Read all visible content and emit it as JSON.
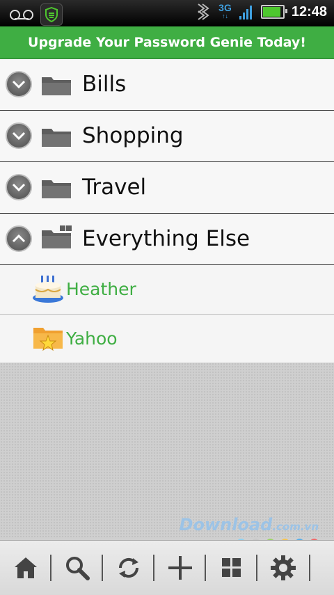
{
  "status_bar": {
    "time": "12:48",
    "network_type": "3G",
    "battery_level": 0.85,
    "icons": [
      "voicemail-icon",
      "lookout-shield-icon",
      "data-sync-icon",
      "3g-icon",
      "signal-icon",
      "battery-icon"
    ]
  },
  "banner": {
    "text": "Upgrade Your Password Genie Today!"
  },
  "folders": [
    {
      "label": "Bills",
      "expanded": false
    },
    {
      "label": "Shopping",
      "expanded": false
    },
    {
      "label": "Travel",
      "expanded": false
    },
    {
      "label": "Everything Else",
      "expanded": true
    }
  ],
  "entries": [
    {
      "label": "Heather",
      "icon": "birthday-cake-icon"
    },
    {
      "label": "Yahoo",
      "icon": "star-folder-icon"
    }
  ],
  "watermark": {
    "text": "Download",
    "suffix": ".com.vn"
  },
  "toolbar": {
    "buttons": [
      "home-icon",
      "search-icon",
      "sync-icon",
      "add-icon",
      "grid-icon",
      "settings-icon"
    ]
  },
  "colors": {
    "accent_green": "#3fae43",
    "status_bar": "#000000",
    "toolbar": "#e3e3e3"
  }
}
